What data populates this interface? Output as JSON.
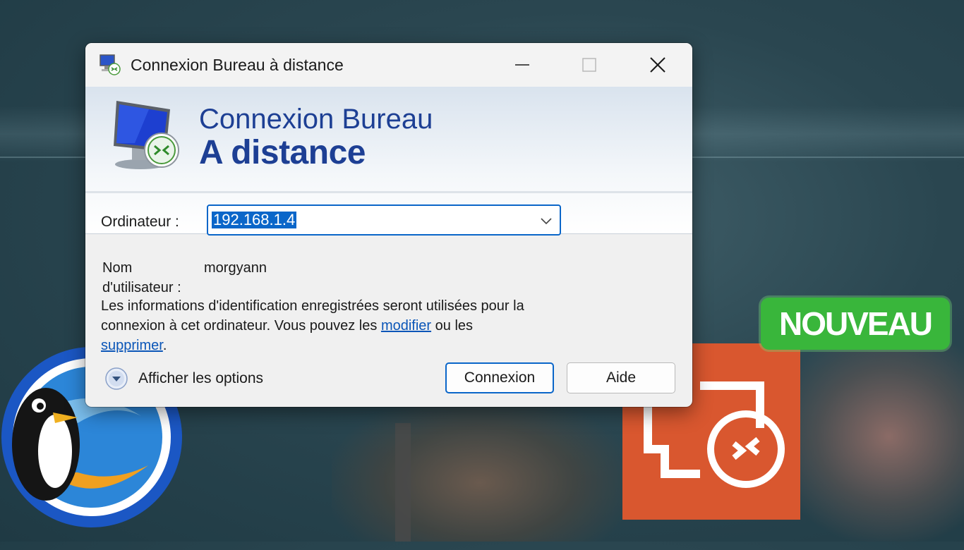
{
  "window": {
    "title": "Connexion Bureau à distance",
    "controls": {
      "minimize": "minimize",
      "maximize": "maximize",
      "close": "close"
    }
  },
  "banner": {
    "line1": "Connexion Bureau",
    "line2": "A distance"
  },
  "form": {
    "computer_label": "Ordinateur :",
    "computer_value": "192.168.1.4",
    "user_label": "Nom d'utilisateur :",
    "user_value": "morgyann",
    "info_before": "Les informations d'identification enregistrées seront utilisées pour la connexion à cet ordinateur. Vous pouvez les ",
    "info_link_modify": "modifier",
    "info_middle": " ou les ",
    "info_link_delete": "supprimer",
    "info_after": "."
  },
  "footer": {
    "options_label": "Afficher les options",
    "connect_label": "Connexion",
    "help_label": "Aide"
  },
  "background": {
    "badge_text": "NOUVEAU"
  },
  "colors": {
    "accent": "#0a66c9",
    "banner_text": "#1d3f94",
    "rdp_tile": "#d9572f",
    "badge": "#39b63b"
  }
}
